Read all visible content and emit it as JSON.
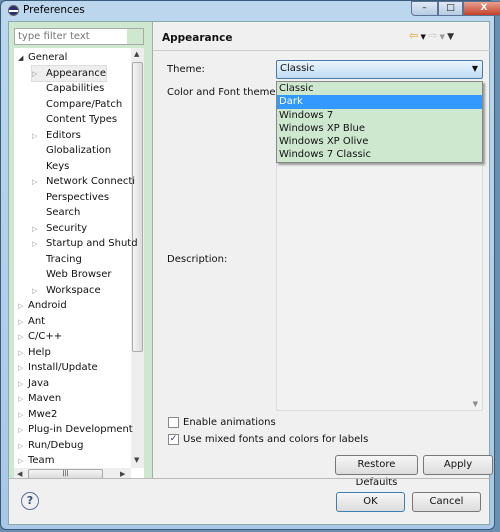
{
  "window": {
    "title": "Preferences",
    "minimize": "–",
    "maximize": "□",
    "close": "X"
  },
  "sidebar": {
    "filter_placeholder": "type filter text",
    "items": [
      {
        "label": "General",
        "level": 0,
        "expanded": true
      },
      {
        "label": "Appearance",
        "level": 1,
        "expandable": true,
        "selected": true
      },
      {
        "label": "Capabilities",
        "level": 1
      },
      {
        "label": "Compare/Patch",
        "level": 1
      },
      {
        "label": "Content Types",
        "level": 1
      },
      {
        "label": "Editors",
        "level": 1,
        "expandable": true
      },
      {
        "label": "Globalization",
        "level": 1
      },
      {
        "label": "Keys",
        "level": 1
      },
      {
        "label": "Network Connecti",
        "level": 1,
        "expandable": true
      },
      {
        "label": "Perspectives",
        "level": 1
      },
      {
        "label": "Search",
        "level": 1
      },
      {
        "label": "Security",
        "level": 1,
        "expandable": true
      },
      {
        "label": "Startup and Shutd",
        "level": 1,
        "expandable": true
      },
      {
        "label": "Tracing",
        "level": 1
      },
      {
        "label": "Web Browser",
        "level": 1
      },
      {
        "label": "Workspace",
        "level": 1,
        "expandable": true
      },
      {
        "label": "Android",
        "level": 0,
        "expandable": true
      },
      {
        "label": "Ant",
        "level": 0,
        "expandable": true
      },
      {
        "label": "C/C++",
        "level": 0,
        "expandable": true
      },
      {
        "label": "Help",
        "level": 0,
        "expandable": true
      },
      {
        "label": "Install/Update",
        "level": 0,
        "expandable": true
      },
      {
        "label": "Java",
        "level": 0,
        "expandable": true
      },
      {
        "label": "Maven",
        "level": 0,
        "expandable": true
      },
      {
        "label": "Mwe2",
        "level": 0,
        "expandable": true
      },
      {
        "label": "Plug-in Development",
        "level": 0,
        "expandable": true
      },
      {
        "label": "Run/Debug",
        "level": 0,
        "expandable": true
      },
      {
        "label": "Team",
        "level": 0,
        "expandable": true
      }
    ]
  },
  "page": {
    "title": "Appearance",
    "theme_label": "Theme:",
    "theme_value": "Classic",
    "theme_options": [
      "Classic",
      "Dark",
      "Windows 7",
      "Windows XP Blue",
      "Windows XP Olive",
      "Windows 7 Classic"
    ],
    "highlighted_option": "Dark",
    "color_font_label": "Color and Font theme:",
    "description_label": "Description:",
    "enable_animations": {
      "label": "Enable animations",
      "checked": false
    },
    "mixed_fonts": {
      "label": "Use mixed fonts and colors for labels",
      "checked": true
    },
    "restore_defaults": "Restore Defaults",
    "apply": "Apply"
  },
  "footer": {
    "ok": "OK",
    "cancel": "Cancel",
    "help": "?"
  },
  "colors": {
    "accent": "#3399ff",
    "sidebar_bg": "#cde8cf"
  }
}
